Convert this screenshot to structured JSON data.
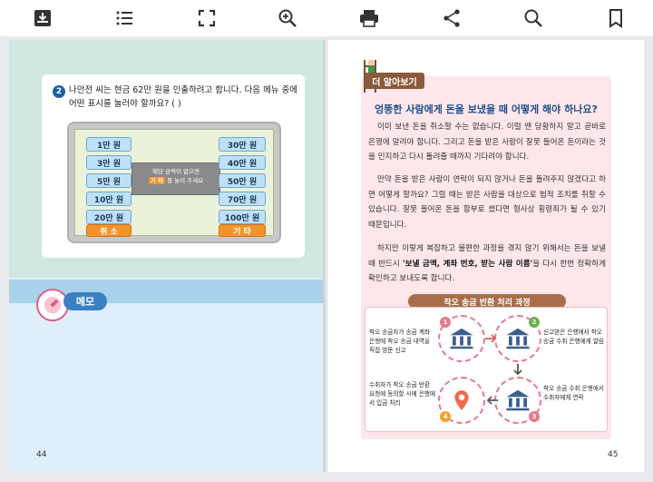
{
  "toolbar": {
    "items": [
      "download-icon",
      "list-icon",
      "fullscreen-icon",
      "zoom-in-icon",
      "print-icon",
      "share-icon",
      "search-icon",
      "bookmark-icon"
    ]
  },
  "left_page": {
    "question": {
      "number": "2",
      "text": "나안전 씨는 현금 62만 원을 인출하려고 합니다. 다음 메뉴 중에 어떤 표시를 눌러야 할까요? (          )"
    },
    "atm": {
      "left_buttons": [
        "1만 원",
        "3만 원",
        "5만 원",
        "10만 원",
        "20만 원"
      ],
      "right_buttons": [
        "30만 원",
        "40만 원",
        "50만 원",
        "70만 원",
        "100만 원"
      ],
      "cancel_label": "취   소",
      "other_label": "기   타",
      "message_line1": "해당 금액이 없으면",
      "message_highlight": "기 타",
      "message_line2": "를 눌러 주세요"
    },
    "memo_label": "메모",
    "page_number": "44"
  },
  "right_page": {
    "tag": "더 알아보기",
    "title": "엉뚱한 사람에게 돈을 보냈을 때 어떻게 해야 하나요?",
    "para1": "이미 보낸 돈을 취소할 수는 없습니다. 이럴 땐 당황하지 말고 곧바로 은행에 알려야 합니다. 그리고 돈을 받은 사람이 잘못 들어온 돈이라는 것을 인지하고 다시 돌려줄 때까지 기다려야 합니다.",
    "para2": "만약 돈을 받은 사람이 연락이 되지 않거나 돈을 돌려주지 않겠다고 하면 어떻게 할까요? 그럴 때는 받은 사람을 대상으로 법적 조치를 취할 수 있습니다. 잘못 들어온 돈을 함부로 썼다면 형사상 횡령죄가 될 수 있기 때문입니다.",
    "para3_a": "하지만 이렇게 복잡하고 불편한 과정을 겪지 않기 위해서는 돈을 보낼 때 반드시 ",
    "para3_bold": "'보낼 금액, 계좌 번호, 받는 사람 이름'",
    "para3_b": "을 다시 한번 정확하게 확인하고 보내도록 합니다.",
    "process_title": "착오 송금 반환 처리 과정",
    "steps": [
      {
        "n": "1",
        "text": "착오 송금자가 송금 계좌 은행에 착오 송금 내역을 직접 방문 신고"
      },
      {
        "n": "2",
        "text": "신고받은 은행에서 착오 송금 수취 은행에게 알림"
      },
      {
        "n": "3",
        "text": "착오 송금 수취 은행에서 수취자에게 연락"
      },
      {
        "n": "4",
        "text": "수취자가 착오 송금 반환 요청에 동의할 시에 은행에서 입금 처리"
      }
    ],
    "page_number": "45"
  },
  "colors": {
    "mint": "#cfe8e1",
    "light_blue": "#dfeef8",
    "pink": "#fde7ea",
    "brown": "#8a5a3c",
    "orange": "#f5922a"
  }
}
